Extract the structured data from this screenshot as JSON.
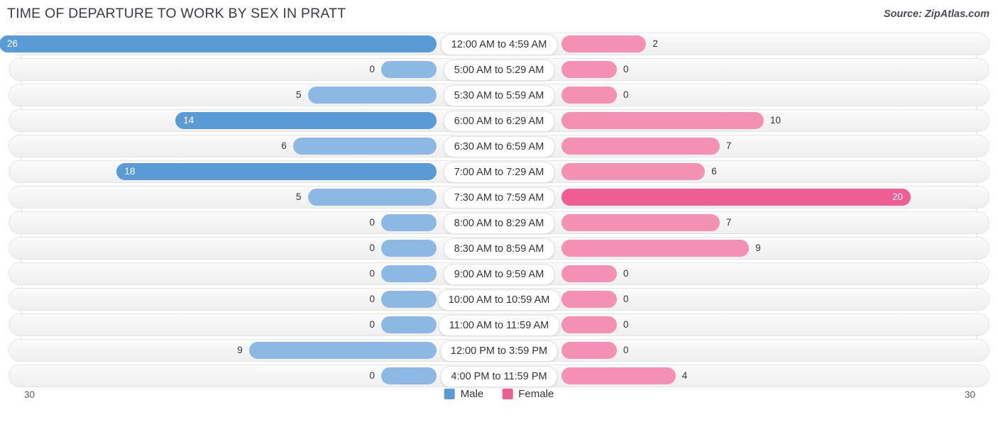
{
  "header": {
    "title": "TIME OF DEPARTURE TO WORK BY SEX IN PRATT",
    "source": "Source: ZipAtlas.com"
  },
  "axis": {
    "left_max": "30",
    "right_max": "30"
  },
  "legend": {
    "items": [
      {
        "label": "Male",
        "color": "#5b9bd5"
      },
      {
        "label": "Female",
        "color": "#ef5e92"
      }
    ]
  },
  "chart_data": {
    "type": "bar",
    "subtype": "diverging-bidirectional",
    "title": "TIME OF DEPARTURE TO WORK BY SEX IN PRATT",
    "xlabel": "",
    "ylabel": "",
    "xlim": [
      30,
      30
    ],
    "grid": true,
    "legend_position": "bottom-center",
    "categories": [
      "12:00 AM to 4:59 AM",
      "5:00 AM to 5:29 AM",
      "5:30 AM to 5:59 AM",
      "6:00 AM to 6:29 AM",
      "6:30 AM to 6:59 AM",
      "7:00 AM to 7:29 AM",
      "7:30 AM to 7:59 AM",
      "8:00 AM to 8:29 AM",
      "8:30 AM to 8:59 AM",
      "9:00 AM to 9:59 AM",
      "10:00 AM to 10:59 AM",
      "11:00 AM to 11:59 AM",
      "12:00 PM to 3:59 PM",
      "4:00 PM to 11:59 PM"
    ],
    "series": [
      {
        "name": "Male",
        "color": "#5b9bd5",
        "values": [
          26,
          0,
          5,
          14,
          6,
          18,
          5,
          0,
          0,
          0,
          0,
          0,
          9,
          0
        ]
      },
      {
        "name": "Female",
        "color": "#ef5e92",
        "values": [
          2,
          0,
          0,
          10,
          7,
          6,
          20,
          7,
          9,
          0,
          0,
          0,
          0,
          4
        ]
      }
    ]
  },
  "rows": [
    {
      "label": "12:00 AM to 4:59 AM",
      "male": "26",
      "female": "2"
    },
    {
      "label": "5:00 AM to 5:29 AM",
      "male": "0",
      "female": "0"
    },
    {
      "label": "5:30 AM to 5:59 AM",
      "male": "5",
      "female": "0"
    },
    {
      "label": "6:00 AM to 6:29 AM",
      "male": "14",
      "female": "10"
    },
    {
      "label": "6:30 AM to 6:59 AM",
      "male": "6",
      "female": "7"
    },
    {
      "label": "7:00 AM to 7:29 AM",
      "male": "18",
      "female": "6"
    },
    {
      "label": "7:30 AM to 7:59 AM",
      "male": "5",
      "female": "20"
    },
    {
      "label": "8:00 AM to 8:29 AM",
      "male": "0",
      "female": "7"
    },
    {
      "label": "8:30 AM to 8:59 AM",
      "male": "0",
      "female": "9"
    },
    {
      "label": "9:00 AM to 9:59 AM",
      "male": "0",
      "female": "0"
    },
    {
      "label": "10:00 AM to 10:59 AM",
      "male": "0",
      "female": "0"
    },
    {
      "label": "11:00 AM to 11:59 AM",
      "male": "0",
      "female": "0"
    },
    {
      "label": "12:00 PM to 3:59 PM",
      "male": "9",
      "female": "0"
    },
    {
      "label": "4:00 PM to 11:59 PM",
      "male": "0",
      "female": "4"
    }
  ]
}
